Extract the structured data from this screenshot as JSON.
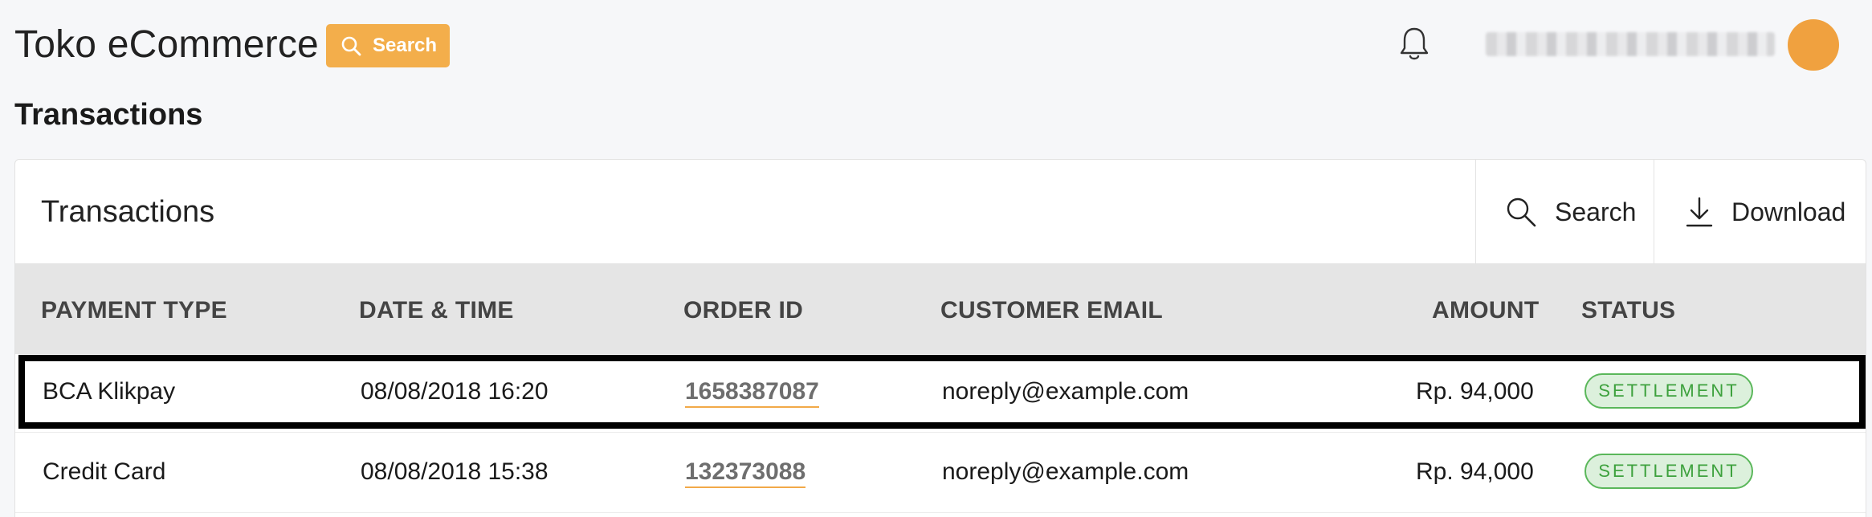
{
  "app": {
    "title": "Toko eCommerce",
    "search_label": "Search"
  },
  "page": {
    "title": "Transactions"
  },
  "card": {
    "title": "Transactions",
    "actions": {
      "search": "Search",
      "download": "Download"
    }
  },
  "table": {
    "headers": [
      "PAYMENT TYPE",
      "DATE & TIME",
      "ORDER ID",
      "CUSTOMER EMAIL",
      "AMOUNT",
      "STATUS"
    ],
    "rows": [
      {
        "payment_type": "BCA Klikpay",
        "datetime": "08/08/2018 16:20",
        "order_id": "1658387087",
        "email": "noreply@example.com",
        "amount": "Rp. 94,000",
        "status": "SETTLEMENT"
      },
      {
        "payment_type": "Credit Card",
        "datetime": "08/08/2018 15:38",
        "order_id": "132373088",
        "email": "noreply@example.com",
        "amount": "Rp. 94,000",
        "status": "SETTLEMENT"
      }
    ]
  },
  "icons": {
    "top_search": "search-icon",
    "notifications": "bell-icon",
    "card_search": "search-icon",
    "download": "download-icon"
  },
  "colors": {
    "accent": "#f3ae4b",
    "avatar": "#f0a13f",
    "status_settlement_bg": "#dcf0dc",
    "status_settlement_text": "#3da13d",
    "selected_row_outline": "#000000"
  }
}
